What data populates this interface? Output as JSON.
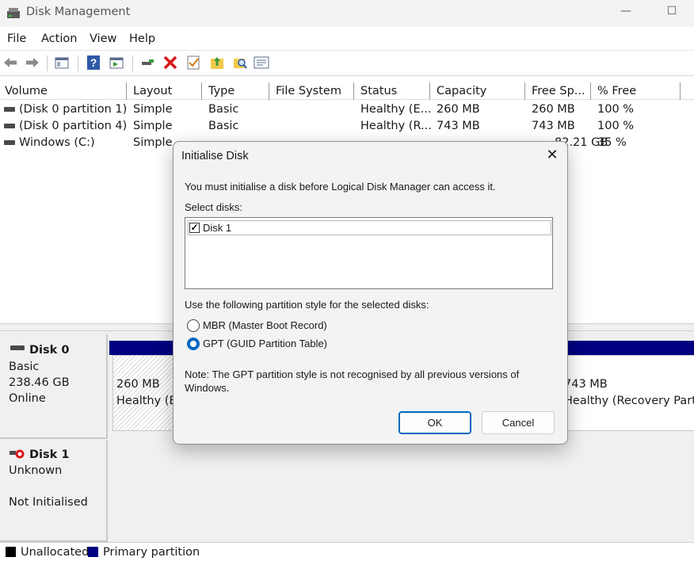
{
  "window": {
    "title": "Disk Management",
    "minimize_glyph": "—",
    "maximize_glyph": "☐"
  },
  "menu": [
    "File",
    "Action",
    "View",
    "Help"
  ],
  "toolbar_icons": [
    "back-arrow-icon",
    "forward-arrow-icon",
    "console-tree-icon",
    "help-icon",
    "properties-icon",
    "connect-icon",
    "delete-icon",
    "check-icon",
    "folder-up-icon",
    "search-folder-icon",
    "list-view-icon"
  ],
  "volume_list": {
    "columns": [
      "Volume",
      "Layout",
      "Type",
      "File System",
      "Status",
      "Capacity",
      "Free Sp...",
      "% Free"
    ],
    "rows": [
      {
        "volume": "(Disk 0 partition 1)",
        "layout": "Simple",
        "type": "Basic",
        "fs": "",
        "status": "Healthy (E...",
        "capacity": "260 MB",
        "free": "260 MB",
        "pct": "100 %"
      },
      {
        "volume": "(Disk 0 partition 4)",
        "layout": "Simple",
        "type": "Basic",
        "fs": "",
        "status": "Healthy (R...",
        "capacity": "743 MB",
        "free": "743 MB",
        "pct": "100 %"
      },
      {
        "volume": "Windows (C:)",
        "layout": "Simple",
        "type": "",
        "fs": "",
        "status": "",
        "capacity": "",
        "free": "82.21 GB",
        "pct": "35 %"
      }
    ]
  },
  "disks": [
    {
      "name": "Disk 0",
      "type": "Basic",
      "size": "238.46 GB",
      "state": "Online",
      "partitions": [
        {
          "size": "260 MB",
          "status": "Healthy (EF"
        },
        {
          "size": "743 MB",
          "status": "Healthy (Recovery Partiti"
        }
      ]
    },
    {
      "name": "Disk 1",
      "type": "Unknown",
      "state": "Not Initialised"
    }
  ],
  "legend": [
    {
      "label": "Unallocated",
      "color": "#000000"
    },
    {
      "label": "Primary partition",
      "color": "#000080"
    }
  ],
  "dialog": {
    "title": "Initialise Disk",
    "close_glyph": "✕",
    "intro": "You must initialise a disk before Logical Disk Manager can access it.",
    "select_label": "Select disks:",
    "disks": [
      {
        "label": "Disk 1",
        "checked": true
      }
    ],
    "style_label": "Use the following partition style for the selected disks:",
    "options": [
      {
        "label": "MBR (Master Boot Record)",
        "selected": false
      },
      {
        "label": "GPT (GUID Partition Table)",
        "selected": true
      }
    ],
    "note_line1": "Note: The GPT partition style is not recognised by all previous versions of",
    "note_line2": "Windows.",
    "ok_label": "OK",
    "cancel_label": "Cancel"
  }
}
